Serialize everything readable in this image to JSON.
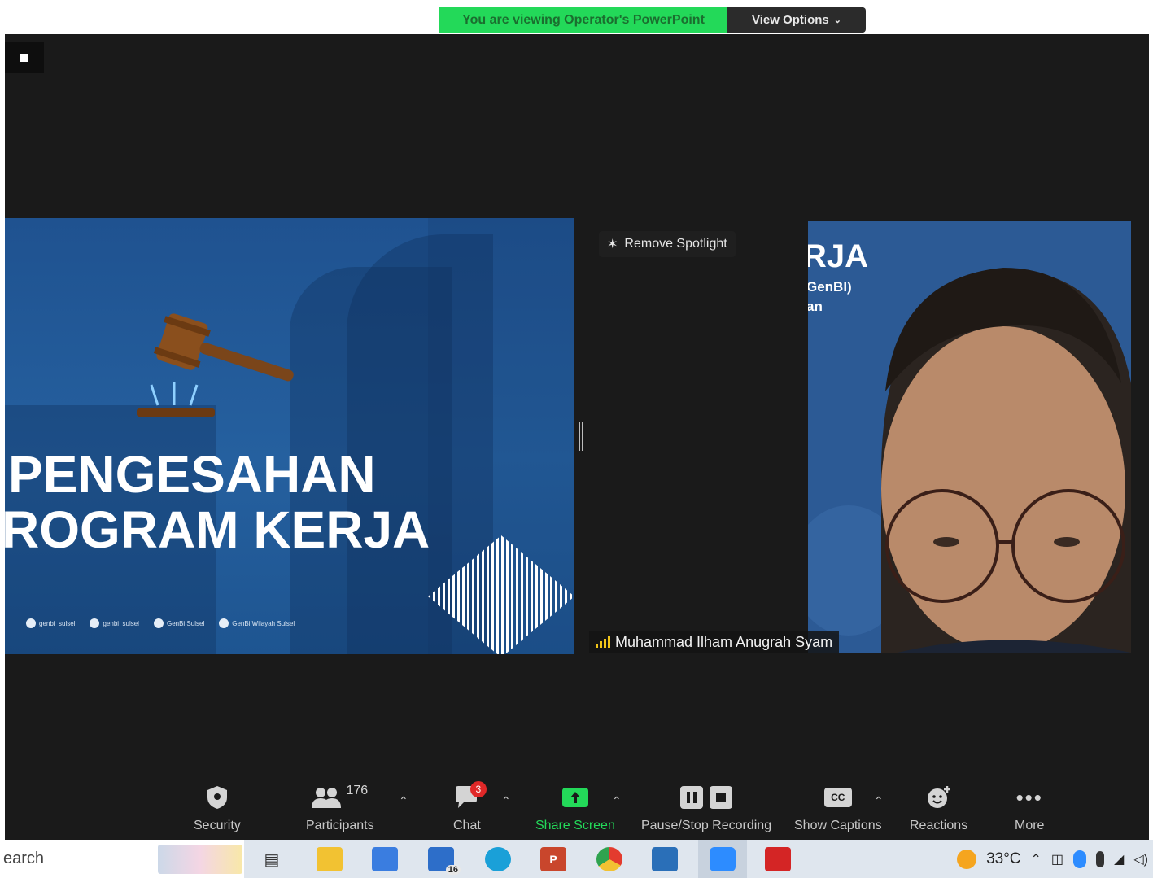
{
  "banner": {
    "viewing_text": "You are viewing Operator's PowerPoint",
    "view_options_label": "View Options",
    "view_options_icon": "chevron-down-icon"
  },
  "slide": {
    "title_line1": "PENGESAHAN",
    "title_line2": "ROGRAM KERJA",
    "socials": [
      "genbi_sulsel",
      "genbi_sulsel",
      "GenBi Sulsel",
      "GenBi Wilayah Sulsel"
    ]
  },
  "spotlight": {
    "label": "Remove Spotlight"
  },
  "video": {
    "participant_name": "Muhammad Ilham Anugrah Syam",
    "bg_text1": "RJA",
    "bg_text2": "GenBI)",
    "bg_text3": "an"
  },
  "toolbar": {
    "security": "Security",
    "participants": "Participants",
    "participants_count": "176",
    "chat": "Chat",
    "chat_badge": "3",
    "share_screen": "Share Screen",
    "recording": "Pause/Stop Recording",
    "captions": "Show Captions",
    "captions_icon_text": "CC",
    "reactions": "Reactions",
    "more": "More"
  },
  "taskbar": {
    "search_text": "earch",
    "mail_badge": "16",
    "temperature": "33°C"
  },
  "colors": {
    "banner_green": "#23d959",
    "share_green": "#23d959",
    "meeting_bg": "#1a1a1a",
    "slide_blue": "#25609f",
    "badge_red": "#e02828"
  }
}
